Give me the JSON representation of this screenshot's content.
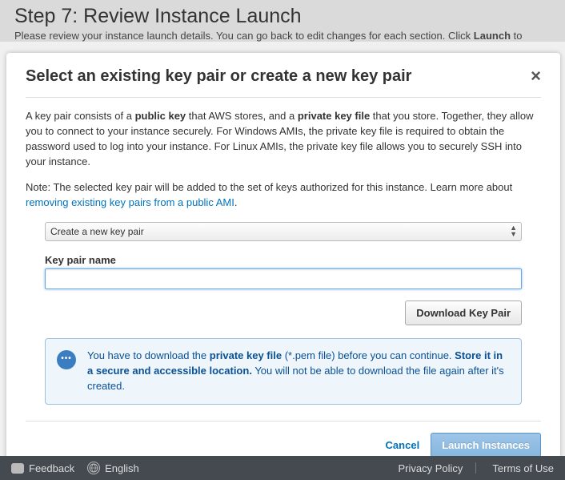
{
  "backdrop": {
    "title": "Step 7: Review Instance Launch",
    "subtitle_prefix": "Please review your instance launch details. You can go back to edit changes for each section. Click ",
    "subtitle_bold": "Launch",
    "subtitle_suffix": " to"
  },
  "modal": {
    "title": "Select an existing key pair or create a new key pair",
    "body1_pre": "A key pair consists of a ",
    "body1_b1": "public key",
    "body1_mid1": " that AWS stores, and a ",
    "body1_b2": "private key file",
    "body1_post": " that you store. Together, they allow you to connect to your instance securely. For Windows AMIs, the private key file is required to obtain the password used to log into your instance. For Linux AMIs, the private key file allows you to securely SSH into your instance.",
    "body2_pre": "Note: The selected key pair will be added to the set of keys authorized for this instance. Learn more about ",
    "body2_link": "removing existing key pairs from a public AMI",
    "body2_post": ".",
    "select_value": "Create a new key pair",
    "field_label": "Key pair name",
    "input_value": "",
    "download_label": "Download Key Pair",
    "notice_pre": "You have to download the ",
    "notice_b1": "private key file",
    "notice_mid": " (*.pem file) before you can continue. ",
    "notice_b2": "Store it in a secure and accessible location.",
    "notice_post": " You will not be able to download the file again after it's created.",
    "cancel": "Cancel",
    "launch": "Launch Instances"
  },
  "footer": {
    "feedback": "Feedback",
    "language": "English",
    "privacy": "Privacy Policy",
    "terms": "Terms of Use"
  }
}
